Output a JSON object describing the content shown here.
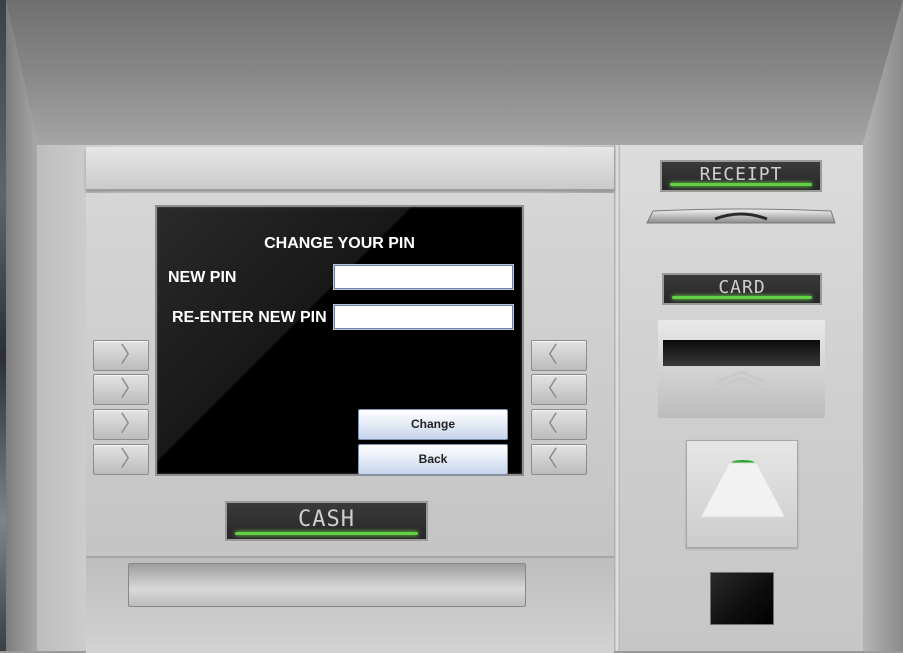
{
  "screen": {
    "title": "CHANGE YOUR PIN",
    "new_pin_label": "NEW PIN",
    "reenter_pin_label": "RE-ENTER NEW PIN",
    "new_pin_value": "",
    "reenter_pin_value": "",
    "change_button": "Change",
    "back_button": "Back"
  },
  "labels": {
    "cash": "CASH",
    "receipt": "RECEIPT",
    "card": "CARD"
  },
  "side_keys": {
    "left_glyph": "〉",
    "right_glyph": "〈"
  },
  "colors": {
    "indicator_green": "#5fd142",
    "screen_background": "#000000"
  }
}
